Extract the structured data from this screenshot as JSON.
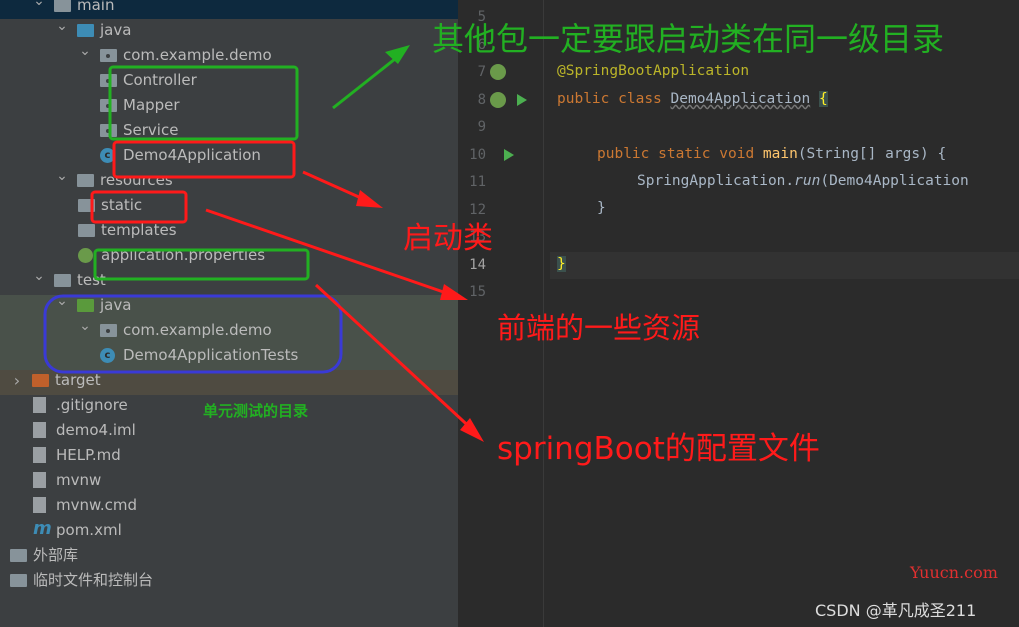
{
  "tree": [
    {
      "label": "main",
      "level": 0,
      "icon": "folder",
      "expanded": true
    },
    {
      "label": "java",
      "level": 1,
      "icon": "source-folder",
      "expanded": true
    },
    {
      "label": "com.example.demo",
      "level": 2,
      "icon": "package",
      "expanded": true
    },
    {
      "label": "Controller",
      "level": 3,
      "icon": "package"
    },
    {
      "label": "Mapper",
      "level": 3,
      "icon": "package"
    },
    {
      "label": "Service",
      "level": 3,
      "icon": "package"
    },
    {
      "label": "Demo4Application",
      "level": 3,
      "icon": "spring-class"
    },
    {
      "label": "resources",
      "level": 1,
      "icon": "resources-folder",
      "expanded": true
    },
    {
      "label": "static",
      "level": 2,
      "icon": "folder"
    },
    {
      "label": "templates",
      "level": 2,
      "icon": "folder"
    },
    {
      "label": "application.properties",
      "level": 2,
      "icon": "spring-properties"
    },
    {
      "label": "test",
      "level": 0,
      "icon": "folder",
      "expanded": true
    },
    {
      "label": "java",
      "level": 1,
      "icon": "test-folder",
      "expanded": true
    },
    {
      "label": "com.example.demo",
      "level": 2,
      "icon": "package",
      "expanded": true
    },
    {
      "label": "Demo4ApplicationTests",
      "level": 3,
      "icon": "test-class"
    },
    {
      "label": "target",
      "level": -1,
      "icon": "excluded-folder",
      "expanded": false
    },
    {
      "label": ".gitignore",
      "level": -0.5,
      "icon": "ignore-file"
    },
    {
      "label": "demo4.iml",
      "level": -0.5,
      "icon": "iml-file"
    },
    {
      "label": "HELP.md",
      "level": -0.5,
      "icon": "markdown-file"
    },
    {
      "label": "mvnw",
      "level": -0.5,
      "icon": "shell-file"
    },
    {
      "label": "mvnw.cmd",
      "level": -0.5,
      "icon": "text-file"
    },
    {
      "label": "pom.xml",
      "level": -0.5,
      "icon": "maven-file"
    },
    {
      "label": "外部库",
      "level": -2,
      "icon": "library"
    },
    {
      "label": "临时文件和控制台",
      "level": -2,
      "icon": "scratches"
    }
  ],
  "editor": {
    "line_numbers": [
      "5",
      "6",
      "7",
      "8",
      "9",
      "10",
      "11",
      "12",
      "13",
      "14",
      "15"
    ],
    "annotation": "@SpringBootApplication",
    "kw_public": "public",
    "kw_class": "class",
    "class_name": "Demo4Application",
    "brace_open": "{",
    "kw_static": "static",
    "kw_void": "void",
    "method": "main",
    "params": "(String[] args) {",
    "call_obj": "SpringApplication.",
    "call_method": "run",
    "call_args": "(Demo4Application",
    "brace_close_inner": "}",
    "brace_close": "}"
  },
  "annotations": {
    "same_level": "其他包一定要跟启动类在同一级目录",
    "startup_class": "启动类",
    "frontend_resources": "前端的一些资源",
    "config_file": "springBoot的配置文件",
    "unit_test_dir": "单元测试的目录",
    "colors": {
      "green": "#22b022",
      "red": "#ff1a1a",
      "blue": "#3a3ad6"
    }
  },
  "watermark": {
    "site": "Yuucn.com",
    "csdn": "CSDN @革凡成圣211"
  }
}
